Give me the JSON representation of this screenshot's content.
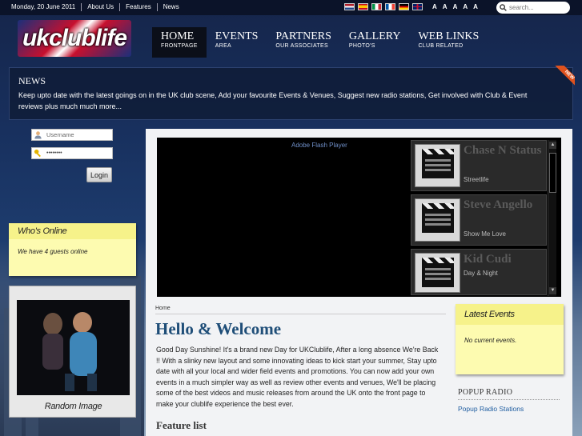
{
  "topbar": {
    "date": "Monday, 20 June 2011",
    "links": [
      "About Us",
      "Features",
      "News"
    ],
    "flags": [
      {
        "name": "nl-flag",
        "colors": [
          "#ae1c28",
          "#ffffff",
          "#21468b"
        ]
      },
      {
        "name": "es-flag",
        "colors": [
          "#c60b1e",
          "#ffc400",
          "#c60b1e"
        ]
      },
      {
        "name": "it-flag",
        "colors": [
          "#009246",
          "#ffffff",
          "#ce2b37"
        ]
      },
      {
        "name": "fr-flag",
        "colors": [
          "#0055a4",
          "#ffffff",
          "#ef4135"
        ]
      },
      {
        "name": "de-flag",
        "colors": [
          "#000000",
          "#dd0000",
          "#ffce00"
        ]
      },
      {
        "name": "uk-flag",
        "colors": [
          "#012169",
          "#ffffff",
          "#c8102e"
        ]
      }
    ],
    "font_sizes": [
      "A",
      "A",
      "A",
      "A",
      "A"
    ],
    "search_placeholder": "search..."
  },
  "logo": {
    "text": "ukclublife"
  },
  "nav": [
    {
      "title": "HOME",
      "sub": "FRONTPAGE",
      "active": true
    },
    {
      "title": "EVENTS",
      "sub": "AREA",
      "active": false
    },
    {
      "title": "PARTNERS",
      "sub": "OUR ASSOCIATES",
      "active": false
    },
    {
      "title": "GALLERY",
      "sub": "PHOTO'S",
      "active": false
    },
    {
      "title": "WEB LINKS",
      "sub": "CLUB RELATED",
      "active": false
    }
  ],
  "news": {
    "title": "NEWS",
    "text": "Keep upto date with the latest goings on in the UK club scene, Add your favourite Events & Venues, Suggest new radio stations, Get involved with Club & Event reviews plus much much more...",
    "badge": "NEW"
  },
  "login": {
    "username_placeholder": "Username",
    "password_value": "••••••••",
    "button": "Login"
  },
  "whos_online": {
    "title": "Who's Online",
    "text": "We have 4 guests online"
  },
  "random_image": {
    "caption": "Random Image"
  },
  "flash": {
    "label": "Adobe Flash Player"
  },
  "videos": [
    {
      "title": "Chase N Status",
      "sub": "Streetlife"
    },
    {
      "title": "Steve Angello",
      "sub": "Show Me Love"
    },
    {
      "title": "Kid Cudi",
      "sub": "Day & Night"
    }
  ],
  "main": {
    "breadcrumb": "Home",
    "heading": "Hello & Welcome",
    "body": "Good Day Sunshine! It's a brand new Day for UKClublife, After a long absence We're Back !! With a slinky new layout and some innovating ideas to kick start your summer, Stay upto date with all your local and wider field events and promotions. You can now add your own events in a much simpler way as well as review other events and venues, We'll be placing some of the best videos and music releases from around the UK onto the front page to make your clublife experience the best ever.",
    "subheading": "Feature list"
  },
  "latest_events": {
    "title": "Latest Events",
    "text": "No current events."
  },
  "popup_radio": {
    "title": "POPUP RADIO",
    "link": "Popup Radio Stations"
  }
}
